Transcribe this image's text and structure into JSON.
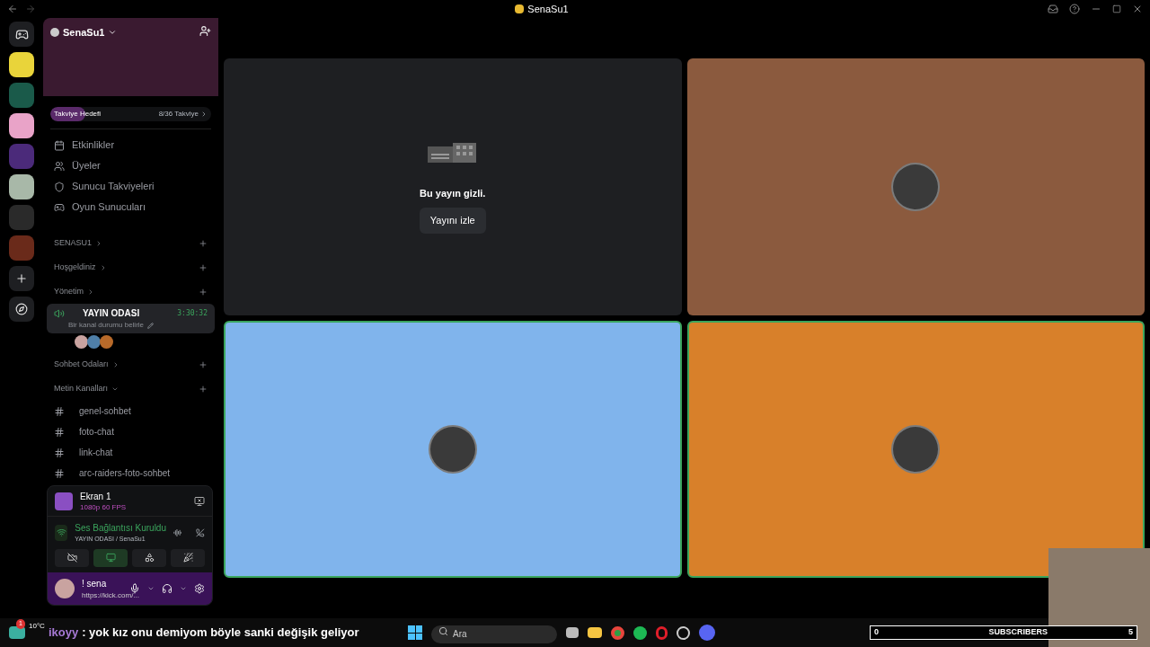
{
  "window": {
    "title": "SenaSu1"
  },
  "server": {
    "name": "SenaSu1",
    "boost": {
      "label": "Takviye Hedefi",
      "count": "8/36 Takviye",
      "level": 0.22
    }
  },
  "nav": [
    {
      "label": "Etkinlikler",
      "kind": "events"
    },
    {
      "label": "Üyeler",
      "kind": "members"
    },
    {
      "label": "Sunucu Takviyeleri",
      "kind": "boosts"
    },
    {
      "label": "Oyun Sunucuları",
      "kind": "games"
    }
  ],
  "channels": [
    {
      "kind": "category",
      "label": "SENASU1",
      "expanded": false
    },
    {
      "kind": "category",
      "label": "Hoşgeldiniz",
      "expanded": false
    },
    {
      "kind": "category",
      "label": "Yönetim",
      "expanded": false
    },
    {
      "kind": "voice",
      "label": "YAYIN ODASI",
      "timer": "3:30:32",
      "status": "Bir kanal durumu belirle",
      "selected": true,
      "members": [
        {
          "color": "#c9a3a0"
        },
        {
          "color": "#4f7fa8"
        },
        {
          "color": "#b86a2a"
        }
      ]
    },
    {
      "kind": "category",
      "label": "Sohbet Odaları",
      "expanded": false
    },
    {
      "kind": "category",
      "label": "Metin Kanalları",
      "expanded": true
    },
    {
      "kind": "text",
      "label": "genel-sohbet"
    },
    {
      "kind": "text",
      "label": "foto-chat"
    },
    {
      "kind": "text",
      "label": "link-chat"
    },
    {
      "kind": "text",
      "label": "arc-raiders-foto-sohbet"
    }
  ],
  "stream": {
    "title": "Ekran 1",
    "quality": "1080p 60 FPS"
  },
  "voice": {
    "status": "Ses Bağlantısı Kuruldu",
    "channel": "YAYIN ODASI / SenaSu1"
  },
  "user": {
    "name": "! sena",
    "status": "https://kick.com/..."
  },
  "tiles": [
    {
      "kind": "hidden",
      "text": "Bu yayın gizli.",
      "button": "Yayını izle",
      "speaking": false
    },
    {
      "kind": "avatar",
      "color": "#8b5a3e",
      "speaking": false
    },
    {
      "kind": "avatar",
      "color": "#80b4ec",
      "speaking": true
    },
    {
      "kind": "avatar",
      "color": "#d8802a",
      "speaking": true
    }
  ],
  "chat_overlay": {
    "temperature": "10°C",
    "badge": "1",
    "username": "ikoyy",
    "message": ": yok kız onu demiyom böyle sanki değişik geliyor"
  },
  "taskbar": {
    "search_placeholder": "Ara"
  },
  "subscribers": {
    "current": "0",
    "label": "SUBSCRIBERS",
    "goal": "5"
  }
}
